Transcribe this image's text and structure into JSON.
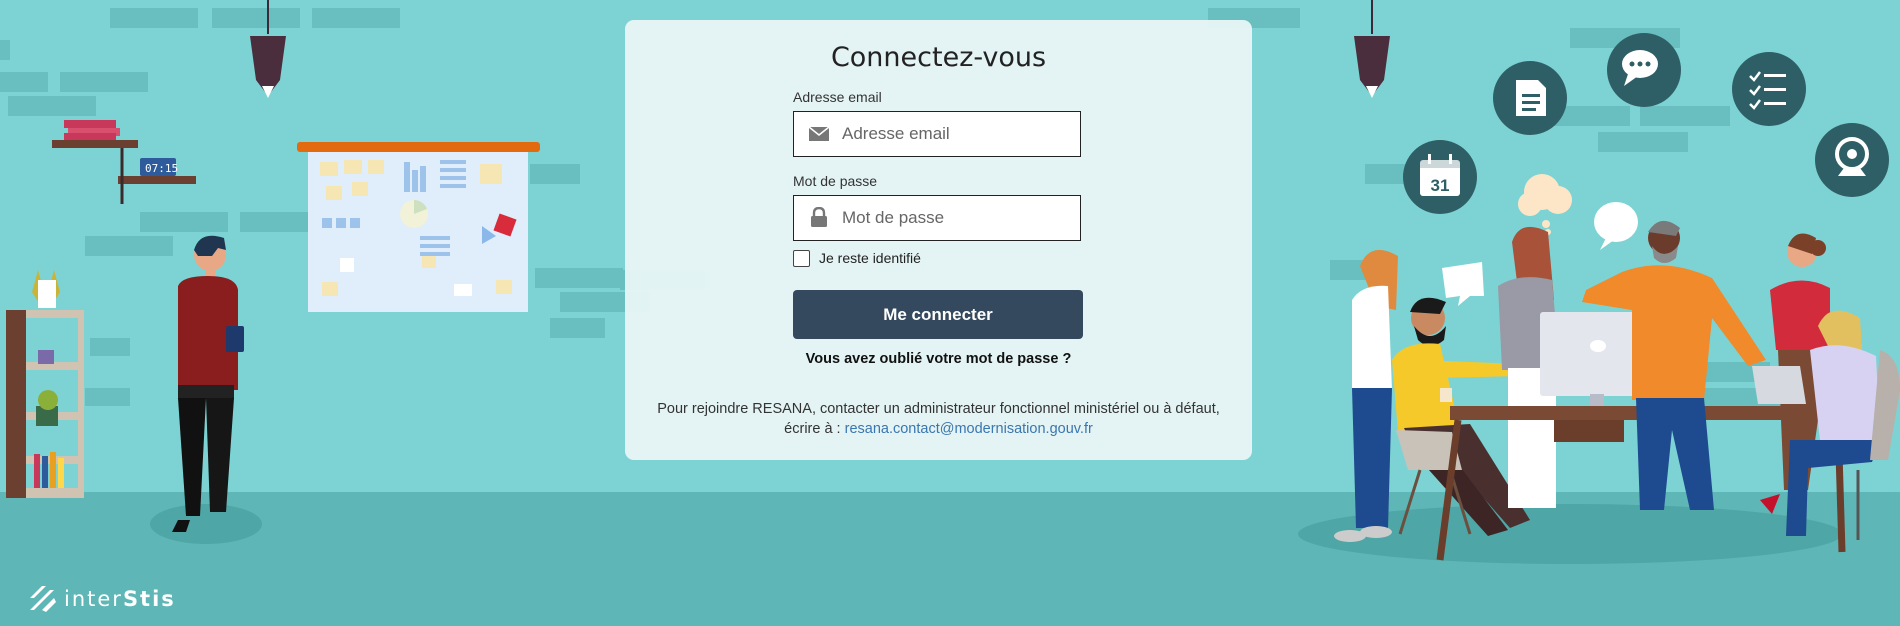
{
  "login": {
    "title": "Connectez-vous",
    "email_label": "Adresse email",
    "email_placeholder": "Adresse email",
    "email_value": "",
    "password_label": "Mot de passe",
    "password_placeholder": "Mot de passe",
    "password_value": "",
    "remember_label": "Je reste identifié",
    "remember_checked": false,
    "submit_label": "Me connecter",
    "forgot_link": "Vous avez oublié votre mot de passe ?",
    "info_text": "Pour rejoindre RESANA, contacter un administrateur fonctionnel ministériel ou à défaut, écrire à :",
    "contact_email": "resana.contact@modernisation.gouv.fr"
  },
  "illustration": {
    "clock_time": "07:15",
    "calendar_day": "31"
  },
  "footer": {
    "logo_light": "inter",
    "logo_bold": "Stis"
  },
  "colors": {
    "background": "#7dd3d3",
    "floor": "#5fb6b6",
    "button": "#34495e",
    "link": "#3a76b0",
    "icon_circle": "#2f5f66"
  }
}
